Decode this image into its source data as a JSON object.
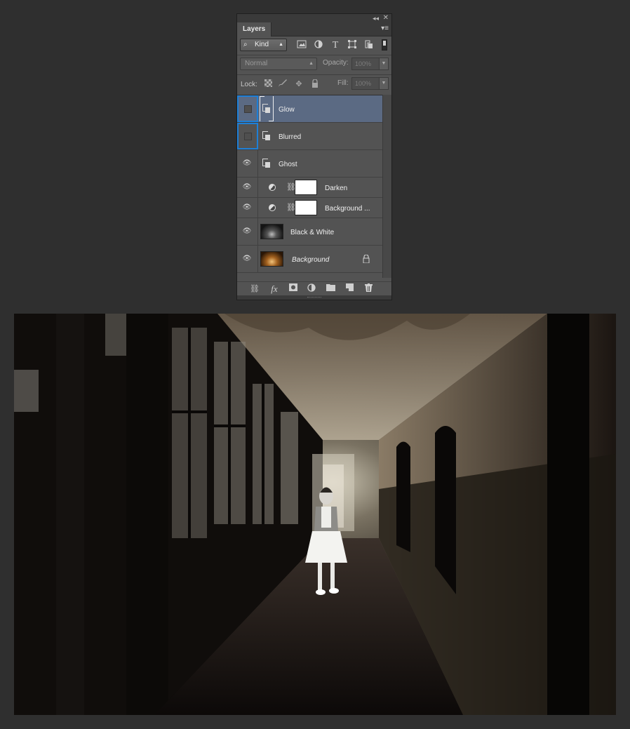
{
  "panel": {
    "tab_label": "Layers",
    "collapse_glyph": "◂◂",
    "close_glyph": "✕",
    "menu_glyph": "▾≡"
  },
  "filter": {
    "kind_label": "Kind",
    "icons": [
      "search-icon",
      "image-filter-icon",
      "adjustment-filter-icon",
      "type-filter-icon",
      "shape-filter-icon",
      "smart-object-filter-icon"
    ]
  },
  "blend": {
    "mode": "Normal",
    "opacity_label": "Opacity:",
    "opacity_value": "100%"
  },
  "lock": {
    "label": "Lock:",
    "fill_label": "Fill:",
    "fill_value": "100%"
  },
  "layers": [
    {
      "name": "Glow",
      "type": "smart-object",
      "visible": false,
      "selected": true
    },
    {
      "name": "Blurred",
      "type": "smart-object",
      "visible": false,
      "selected": false
    },
    {
      "name": "Ghost",
      "type": "smart-object",
      "visible": true,
      "selected": false
    },
    {
      "name": "Darken",
      "type": "adjustment",
      "visible": true,
      "selected": false
    },
    {
      "name": "Background ...",
      "type": "adjustment",
      "visible": true,
      "selected": false
    },
    {
      "name": "Black & White",
      "type": "image",
      "visible": true,
      "selected": false
    },
    {
      "name": "Background",
      "type": "image",
      "visible": true,
      "locked": true,
      "selected": false
    }
  ],
  "bottom_icons": [
    "link-layers-icon",
    "fx-icon",
    "add-mask-icon",
    "new-adjustment-icon",
    "new-group-icon",
    "new-layer-icon",
    "delete-layer-icon"
  ],
  "colors": {
    "panel_bg": "#535353",
    "selected_row": "#5b6a83",
    "highlight_border": "#1e7fd6"
  }
}
